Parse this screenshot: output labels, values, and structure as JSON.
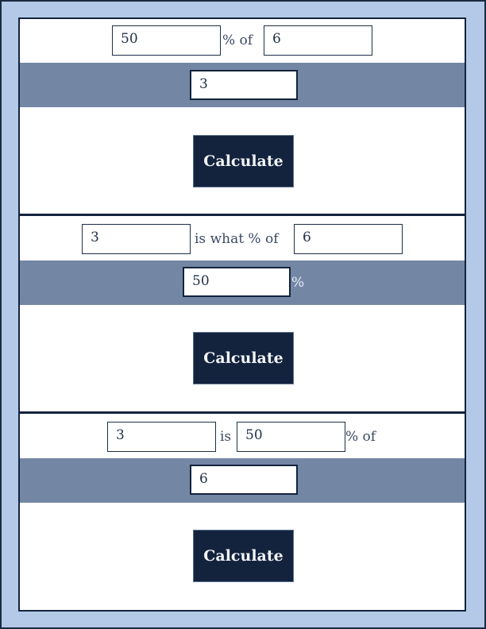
{
  "calculators": [
    {
      "input_a": "50",
      "label_a": "%  of",
      "input_b": "6",
      "result": "3",
      "result_suffix": "",
      "button_label": "Calculate"
    },
    {
      "input_a": "3",
      "label_a": "is what % of",
      "input_b": "6",
      "result": "50",
      "result_suffix": "%",
      "button_label": "Calculate"
    },
    {
      "input_a": "3",
      "label_a": "is",
      "input_b": "50",
      "label_b": "% of",
      "result": "6",
      "button_label": "Calculate"
    }
  ],
  "colors": {
    "outer_bg": "#b4c9e8",
    "band": "#7387a5",
    "button": "#13233d"
  }
}
